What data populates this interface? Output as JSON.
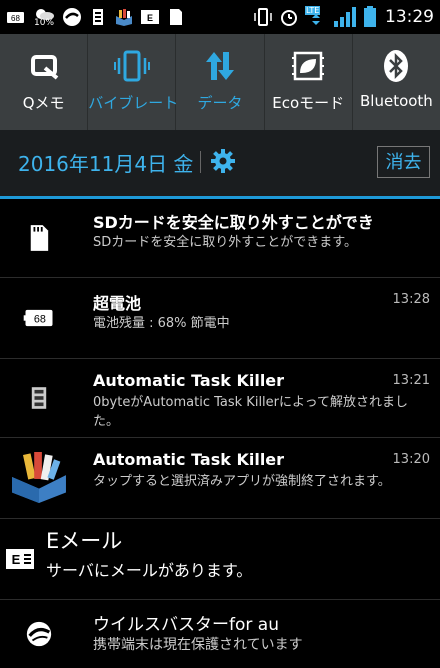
{
  "status_bar": {
    "time": "13:29",
    "battery_small_pct": "10%",
    "sb_battery_label": "68",
    "network": "LTE"
  },
  "quick_settings": [
    {
      "label": "Qメモ",
      "icon": "qmemo-icon"
    },
    {
      "label": "バイブレート",
      "icon": "vibrate-icon"
    },
    {
      "label": "データ",
      "icon": "data-icon"
    },
    {
      "label": "Ecoモード",
      "icon": "eco-icon"
    },
    {
      "label": "Bluetooth",
      "icon": "bluetooth-icon"
    }
  ],
  "date_bar": {
    "date": "2016年11月4日 金",
    "clear_label": "消去"
  },
  "notifications": [
    {
      "title": "SDカードを安全に取り外すことができ",
      "text": "SDカードを安全に取り外すことができます。",
      "time": "",
      "icon": "sd-card-icon"
    },
    {
      "title": "超電池",
      "text": "電池残量 : 68% 節電中",
      "time": "13:28",
      "icon": "battery-saver-icon",
      "icon_label": "68"
    },
    {
      "title": "Automatic Task Killer",
      "text": "0byteがAutomatic Task Killerによって解放されました。",
      "time": "13:21",
      "icon": "task-killer-small-icon"
    },
    {
      "title": "Automatic Task Killer",
      "text": "タップすると選択済みアプリが強制終了されます。",
      "time": "13:20",
      "icon": "task-killer-box-icon"
    },
    {
      "title": "Eメール",
      "text": "サーバにメールがあります。",
      "time": "",
      "icon": "email-icon"
    },
    {
      "title": "ウイルスバスターfor au",
      "text": "携帯端末は現在保護されています",
      "time": "",
      "icon": "virusbuster-icon"
    }
  ]
}
